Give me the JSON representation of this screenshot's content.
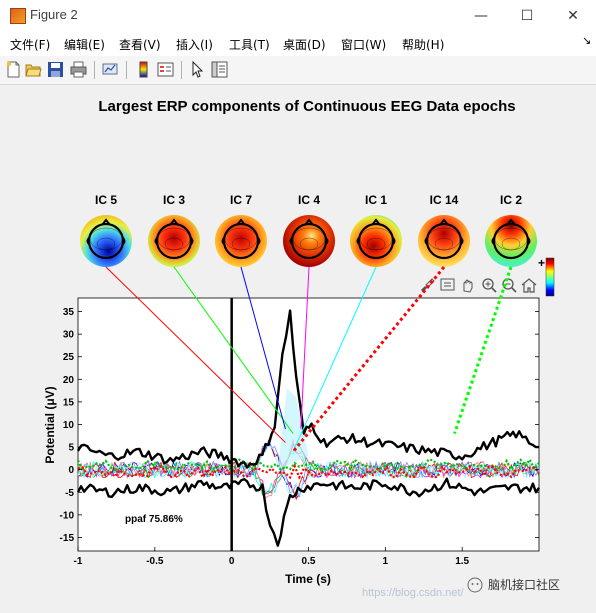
{
  "window": {
    "title": "Figure 2",
    "minimize_icon": "minimize-icon",
    "maximize_icon": "maximize-icon",
    "close_icon": "close-icon"
  },
  "menu": [
    "文件(F)",
    "编辑(E)",
    "查看(V)",
    "插入(I)",
    "工具(T)",
    "桌面(D)",
    "窗口(W)",
    "帮助(H)"
  ],
  "toolbar_icons": [
    "new-figure-icon",
    "open-file-icon",
    "save-icon",
    "print-icon",
    "link-plot-icon",
    "insert-colorbar-icon",
    "insert-legend-icon",
    "edit-plot-icon",
    "property-inspector-icon"
  ],
  "axes_toolbar_icons": [
    "brush-icon",
    "datatip-icon",
    "pan-icon",
    "zoom-in-icon",
    "zoom-out-icon",
    "home-icon"
  ],
  "figure": {
    "title": "Largest ERP components of Continuous EEG Data epochs",
    "ic_labels": [
      "IC 5",
      "IC 3",
      "IC 7",
      "IC 4",
      "IC 1",
      "IC 14",
      "IC 2"
    ],
    "colorbar_plus": "+",
    "annotation": "ppaf 75.86%",
    "watermark_url": "https://blog.csdn.net/",
    "watermark_brand": "脑机接口社区",
    "connector_colors": [
      "#ff0000",
      "#00ff00",
      "#0000ff",
      "#ff00ff",
      "#00ffff",
      "#ff0000",
      "#00ff00"
    ],
    "connector_styles": [
      "solid",
      "solid",
      "solid",
      "solid",
      "solid",
      "dotted",
      "dotted"
    ]
  },
  "chart_data": {
    "type": "line",
    "xlabel": "Time (s)",
    "ylabel": "Potential (μV)",
    "xlim": [
      -1,
      2
    ],
    "ylim": [
      -18,
      38
    ],
    "xticks": [
      -1,
      -0.5,
      0,
      0.5,
      1,
      1.5
    ],
    "yticks": [
      -15,
      -10,
      -5,
      0,
      5,
      10,
      15,
      20,
      25,
      30,
      35
    ],
    "event_line_x": 0,
    "envelope_upper": {
      "x": [
        -1,
        -0.8,
        -0.6,
        -0.4,
        -0.2,
        -0.05,
        0.1,
        0.2,
        0.28,
        0.33,
        0.38,
        0.42,
        0.47,
        0.52,
        0.6,
        0.75,
        0.9,
        1.1,
        1.3,
        1.5,
        1.7,
        1.85,
        2.0
      ],
      "y": [
        5,
        3,
        4,
        2,
        4,
        3,
        1,
        3,
        10,
        25,
        35,
        20,
        8,
        10,
        6,
        7,
        6,
        5,
        4,
        3,
        6,
        8,
        5
      ]
    },
    "envelope_lower": {
      "x": [
        -1,
        -0.8,
        -0.6,
        -0.4,
        -0.2,
        -0.05,
        0.1,
        0.2,
        0.25,
        0.3,
        0.38,
        0.45,
        0.6,
        0.8,
        1.0,
        1.2,
        1.4,
        1.6,
        1.8,
        2.0
      ],
      "y": [
        -4,
        -5,
        -4,
        -5,
        -3,
        -4,
        -3,
        -4,
        -12,
        -16,
        -6,
        -4,
        -3,
        -4,
        -3,
        -5,
        -3,
        -5,
        -4,
        -4
      ]
    }
  }
}
